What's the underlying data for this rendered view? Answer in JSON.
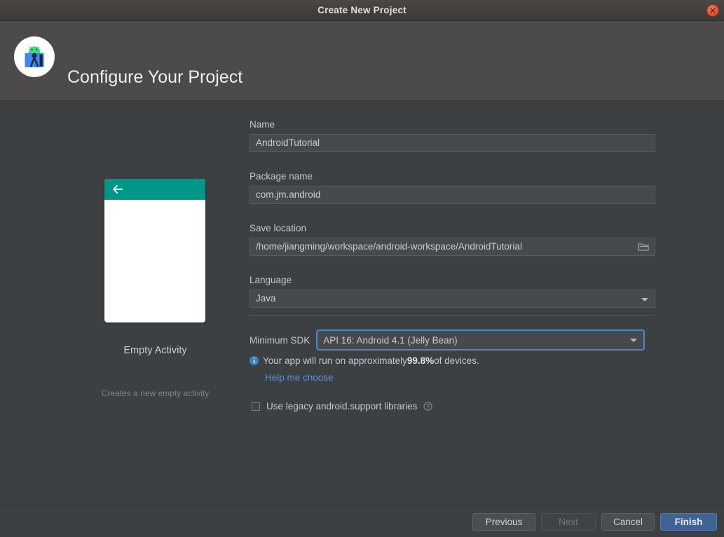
{
  "window": {
    "title": "Create New Project",
    "close_icon": "close-icon"
  },
  "header": {
    "title": "Configure Your Project",
    "logo_icon": "android-studio-logo-icon"
  },
  "preview": {
    "template_name": "Empty Activity",
    "template_description": "Creates a new empty activity",
    "appbar_color": "#009688",
    "back_icon": "back-arrow-icon"
  },
  "form": {
    "name": {
      "label": "Name",
      "value": "AndroidTutorial",
      "placeholder": "Name"
    },
    "package_name": {
      "label": "Package name",
      "value": "com.jm.android",
      "placeholder": "Package name"
    },
    "save_location": {
      "label": "Save location",
      "value": "/home/jiangming/workspace/android-workspace/AndroidTutorial",
      "placeholder": "Save location",
      "browse_icon": "folder-icon"
    },
    "language": {
      "label": "Language",
      "value": "Java",
      "caret_icon": "chevron-down-icon"
    },
    "minimum_sdk": {
      "label": "Minimum SDK",
      "value": "API 16: Android 4.1 (Jelly Bean)",
      "caret_icon": "chevron-down-icon",
      "focus_color": "#4e87c4"
    },
    "sdk_note": {
      "info_icon": "info-icon",
      "prefix": "Your app will run on approximately ",
      "percent": "99.8%",
      "suffix": " of devices.",
      "info_color": "#3b82c4"
    },
    "help_link": {
      "label": "Help me choose",
      "color": "#5b8fd4"
    },
    "legacy_libraries": {
      "label": "Use legacy android.support libraries",
      "checked": false,
      "help_icon": "question-mark-icon"
    }
  },
  "footer": {
    "previous": "Previous",
    "next": "Next",
    "cancel": "Cancel",
    "finish": "Finish",
    "next_enabled": false,
    "default_button_color": "#3f6493"
  }
}
